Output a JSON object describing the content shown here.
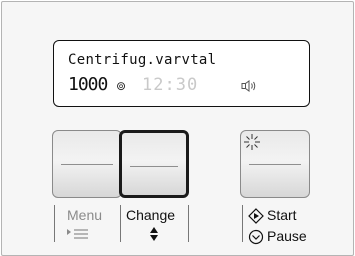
{
  "display": {
    "program_name": "Centrifug.varvtal",
    "spin_speed": "1000",
    "time": "12:30",
    "icons": [
      "spin-icon",
      "speaker-icon"
    ]
  },
  "buttons": {
    "menu_label": "Menu",
    "change_label": "Change",
    "start_label": "Start",
    "pause_label": "Pause",
    "selected": "change"
  },
  "icons": {
    "menu": "menu-arrow-icon",
    "change": "up-down-arrows-icon",
    "start": "start-diamond-icon",
    "pause": "pause-circle-icon",
    "start_button": "sparkle-icon"
  },
  "colors": {
    "panel_bg": "#f6f6f6",
    "inactive_text": "#8b8b8b",
    "dim_time": "#c9c9c9",
    "selected_border": "#1a1a1a"
  }
}
